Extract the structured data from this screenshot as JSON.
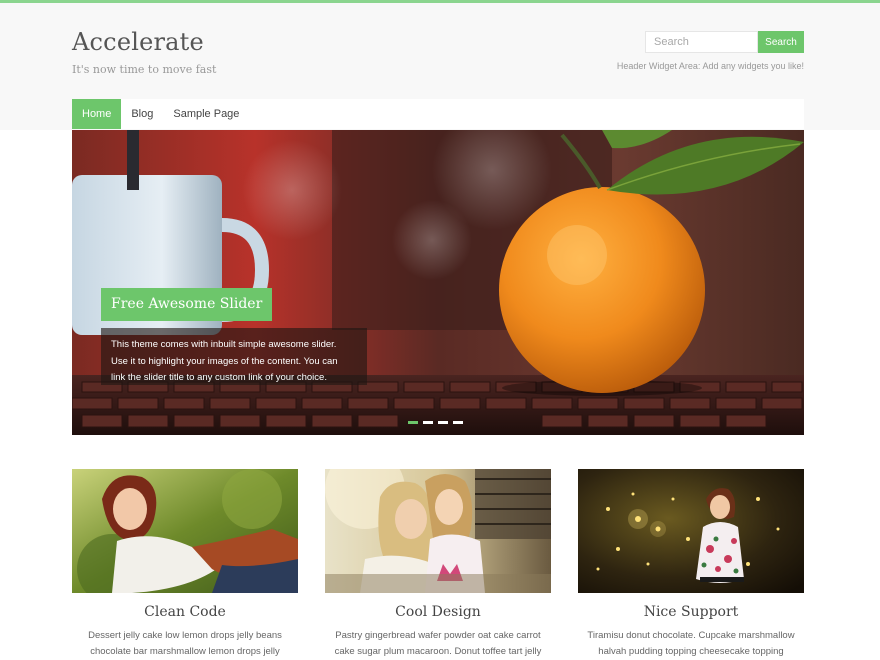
{
  "site": {
    "title": "Accelerate",
    "tagline": "It's now time to move fast",
    "accent_color": "#6dc66b"
  },
  "search": {
    "placeholder": "Search",
    "button_label": "Search"
  },
  "header_widget": {
    "text": "Header Widget Area: Add any widgets you like!"
  },
  "nav": {
    "items": [
      {
        "label": "Home",
        "active": true
      },
      {
        "label": "Blog",
        "active": false
      },
      {
        "label": "Sample Page",
        "active": false
      }
    ]
  },
  "slider": {
    "title": "Free Awesome Slider",
    "description": "This theme comes with inbuilt simple awesome slider.\nUse it to highlight your images of the content. You can\nlink the slider title to any custom link of your choice.",
    "slide_count": 4,
    "active_slide": 1
  },
  "features": [
    {
      "title": "Clean Code",
      "text": "Dessert jelly cake low lemon drops jelly beans\nchocolate bar marshmallow lemon drops jelly"
    },
    {
      "title": "Cool Design",
      "text": "Pastry gingerbread wafer powder oat cake carrot\ncake sugar plum macaroon. Donut toffee tart jelly"
    },
    {
      "title": "Nice Support",
      "text": "Tiramisu donut chocolate. Cupcake marshmallow\nhalvah pudding topping cheesecake topping"
    }
  ]
}
